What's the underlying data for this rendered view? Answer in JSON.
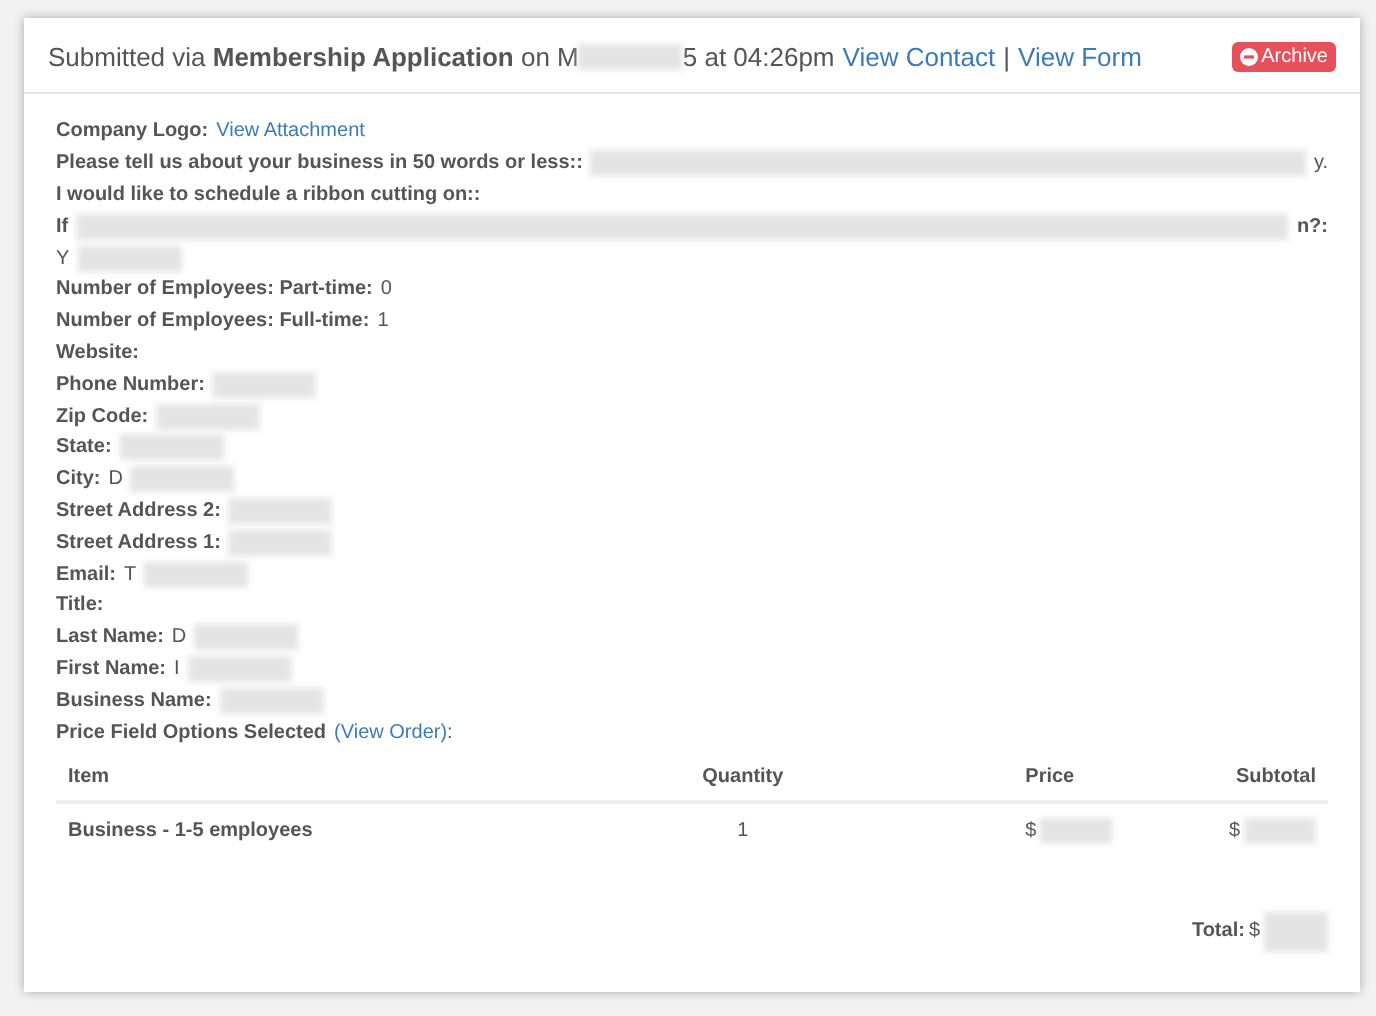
{
  "header": {
    "parts": [
      {
        "kind": "text",
        "text": "Submitted via **Membership Application** on M"
      },
      {
        "kind": "redacted",
        "wide": false
      },
      {
        "kind": "text",
        "text": "5 at 04:26pm"
      },
      {
        "kind": "link",
        "text": "View Contact"
      },
      {
        "kind": "sep",
        "text": "|"
      },
      {
        "kind": "link",
        "text": "View Form"
      }
    ],
    "archive_button": "Archive"
  },
  "fields": [
    {
      "parts": [
        {
          "kind": "label",
          "text": "Company Logo:"
        },
        {
          "kind": "link",
          "text": "View Attachment"
        }
      ]
    },
    {
      "parts": [
        {
          "kind": "label",
          "text": "Please tell us about your business in 50 words or less::"
        },
        {
          "kind": "redacted",
          "wide": true
        },
        {
          "kind": "text",
          "text": "y."
        }
      ]
    },
    {
      "parts": [
        {
          "kind": "label",
          "text": "I would like to schedule a ribbon cutting on::"
        }
      ]
    },
    {
      "parts": [
        {
          "kind": "label",
          "text": "If"
        },
        {
          "kind": "redacted",
          "wide": true
        },
        {
          "kind": "label",
          "text": "n?:"
        }
      ]
    },
    {
      "parts": [
        {
          "kind": "text",
          "text": "Y"
        },
        {
          "kind": "redacted",
          "wide": false
        }
      ]
    },
    {
      "parts": [
        {
          "kind": "label",
          "text": "Number of Employees: Part-time:"
        },
        {
          "kind": "text",
          "text": "0"
        }
      ]
    },
    {
      "parts": [
        {
          "kind": "label",
          "text": "Number of Employees: Full-time:"
        },
        {
          "kind": "text",
          "text": "1"
        }
      ]
    },
    {
      "parts": [
        {
          "kind": "label",
          "text": "Website:"
        }
      ]
    },
    {
      "parts": [
        {
          "kind": "label",
          "text": "Phone Number:"
        },
        {
          "kind": "redacted",
          "wide": false
        }
      ]
    },
    {
      "parts": [
        {
          "kind": "label",
          "text": "Zip Code:"
        },
        {
          "kind": "redacted",
          "wide": false
        }
      ]
    },
    {
      "parts": [
        {
          "kind": "label",
          "text": "State:"
        },
        {
          "kind": "redacted",
          "wide": false
        }
      ]
    },
    {
      "parts": [
        {
          "kind": "label",
          "text": "City:"
        },
        {
          "kind": "text",
          "text": "D"
        },
        {
          "kind": "redacted",
          "wide": false
        }
      ]
    },
    {
      "parts": [
        {
          "kind": "label",
          "text": "Street Address 2:"
        },
        {
          "kind": "redacted",
          "wide": false
        }
      ]
    },
    {
      "parts": [
        {
          "kind": "label",
          "text": "Street Address 1:"
        },
        {
          "kind": "redacted",
          "wide": false
        }
      ]
    },
    {
      "parts": [
        {
          "kind": "label",
          "text": "Email:"
        },
        {
          "kind": "text",
          "text": "T"
        },
        {
          "kind": "redacted",
          "wide": false
        }
      ]
    },
    {
      "parts": [
        {
          "kind": "label",
          "text": "Title:"
        }
      ]
    },
    {
      "parts": [
        {
          "kind": "label",
          "text": "Last Name:"
        },
        {
          "kind": "text",
          "text": "D"
        },
        {
          "kind": "redacted",
          "wide": false
        }
      ]
    },
    {
      "parts": [
        {
          "kind": "label",
          "text": "First Name:"
        },
        {
          "kind": "text",
          "text": "I"
        },
        {
          "kind": "redacted",
          "wide": false
        }
      ]
    },
    {
      "parts": [
        {
          "kind": "label",
          "text": "Business Name:"
        },
        {
          "kind": "redacted",
          "wide": false
        }
      ]
    },
    {
      "parts": [
        {
          "kind": "label",
          "text": "Price Field Options Selected"
        },
        {
          "kind": "link",
          "text": "(View Order)"
        },
        {
          "kind": "tight",
          "text": ":"
        }
      ]
    }
  ],
  "table": {
    "columns": [
      "Item",
      "Quantity",
      "Price",
      "Subtotal"
    ],
    "rows": [
      {
        "item": "Business - 1-5 employees",
        "quantity": "1",
        "price": "$",
        "subtotal": "$"
      }
    ]
  },
  "total": {
    "label": "Total:",
    "currency": "$"
  }
}
